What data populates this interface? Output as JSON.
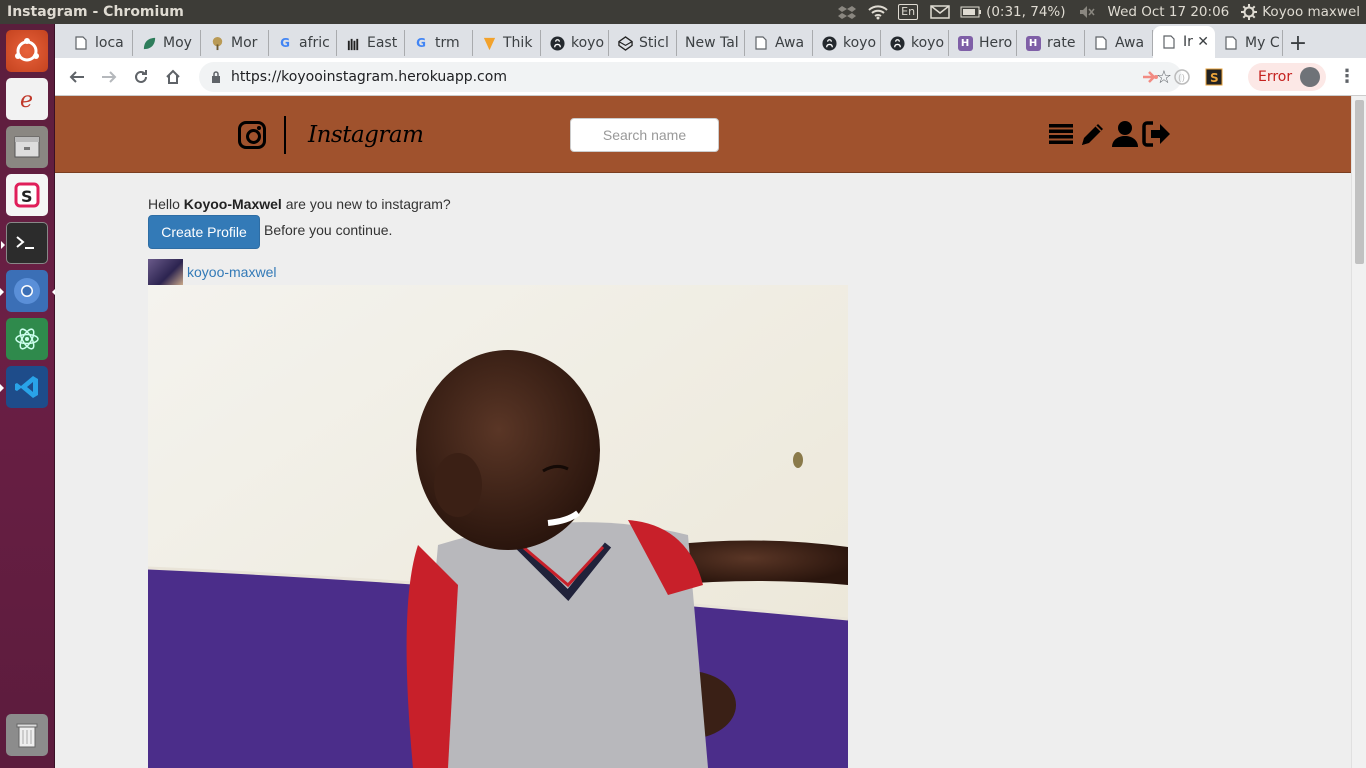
{
  "system": {
    "window_title": "Instagram - Chromium",
    "keyboard": "En",
    "battery": "(0:31, 74%)",
    "clock": "Wed Oct 17 20:06",
    "user": "Koyoo maxwel"
  },
  "tabs": [
    {
      "label": "loca",
      "icon": "doc-icon"
    },
    {
      "label": "Moy",
      "icon": "leaf-icon"
    },
    {
      "label": "Mor",
      "icon": "tree-icon"
    },
    {
      "label": "afric",
      "icon": "google-icon"
    },
    {
      "label": "East",
      "icon": "people-icon"
    },
    {
      "label": "trm",
      "icon": "google-icon"
    },
    {
      "label": "Thik",
      "icon": "brand-icon"
    },
    {
      "label": "koyo",
      "icon": "github-icon"
    },
    {
      "label": "Sticl",
      "icon": "codepen-icon"
    },
    {
      "label": "New Tal",
      "icon": "none"
    },
    {
      "label": "Awa",
      "icon": "doc-icon"
    },
    {
      "label": "koyo",
      "icon": "github-icon"
    },
    {
      "label": "koyo",
      "icon": "github-icon"
    },
    {
      "label": "Hero",
      "icon": "heroku-icon"
    },
    {
      "label": "rate",
      "icon": "heroku-icon"
    },
    {
      "label": "Awa",
      "icon": "doc-icon"
    },
    {
      "label": "Ir",
      "icon": "doc-icon",
      "active": true
    },
    {
      "label": "My C",
      "icon": "doc-icon"
    }
  ],
  "toolbar": {
    "url": "https://koyooinstagram.herokuapp.com",
    "error_label": "Error"
  },
  "site": {
    "brand": "Instagram",
    "search_placeholder": "Search name",
    "greeting_prefix": "Hello ",
    "username_bold": "Koyoo-Maxwel",
    "greeting_suffix": " are you new to instagram?",
    "create_profile_label": "Create Profile",
    "create_profile_after": "Before you continue.",
    "post_author": "koyoo-maxwel",
    "colors": {
      "navbar": "#a0522d",
      "link": "#337ab7",
      "button": "#337ab7"
    }
  }
}
